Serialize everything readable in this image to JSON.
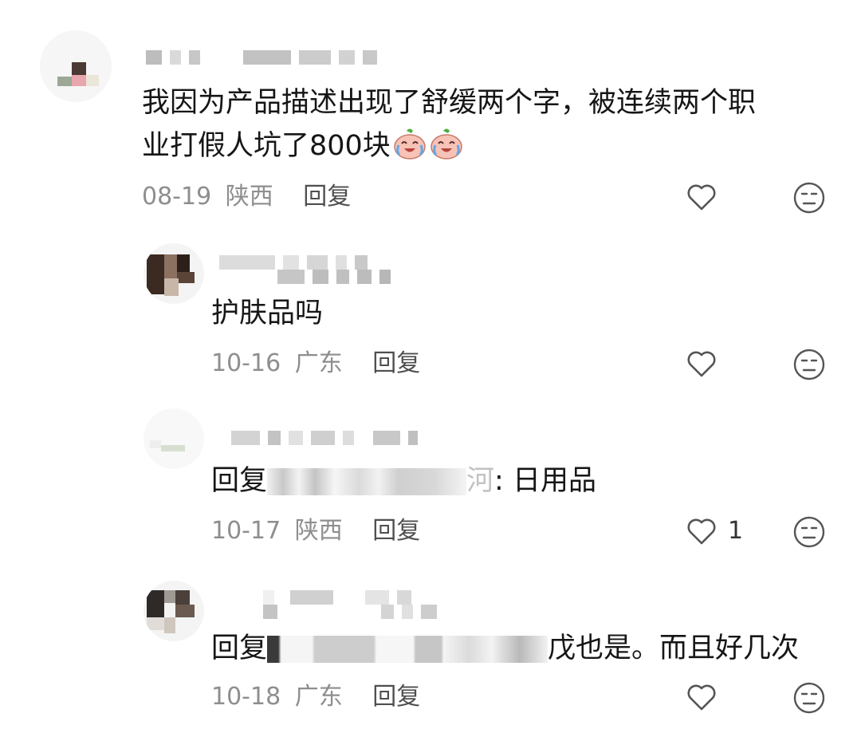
{
  "comments": [
    {
      "text_line1": "我因为产品描述出现了舒缓两个字，被连续两个职",
      "text_line2": "业打假人坑了800块",
      "emoji": [
        "crying-laughing-peach-emoji",
        "crying-laughing-peach-emoji"
      ],
      "date": "08-19",
      "region": "陕西",
      "reply_label": "回复"
    }
  ],
  "replies": [
    {
      "text": "护肤品吗",
      "date": "10-16",
      "region": "广东",
      "reply_label": "回复"
    },
    {
      "reply_prefix": "回复",
      "name_tail": "河",
      "text": ": 日用品",
      "date": "10-17",
      "region": "陕西",
      "reply_label": "回复",
      "likes": "1"
    },
    {
      "reply_prefix": "回复",
      "name_tail": "戊",
      "text": "也是。而且好几次",
      "date": "10-18",
      "region": "广东",
      "reply_label": "回复"
    }
  ],
  "icons": {
    "like": "heart-outline-icon",
    "dislike": "neutral-face-icon"
  },
  "colors": {
    "meta_gray": "#8e8e8e",
    "reply_gray": "#4f4f4f",
    "icon_gray": "#555555"
  }
}
